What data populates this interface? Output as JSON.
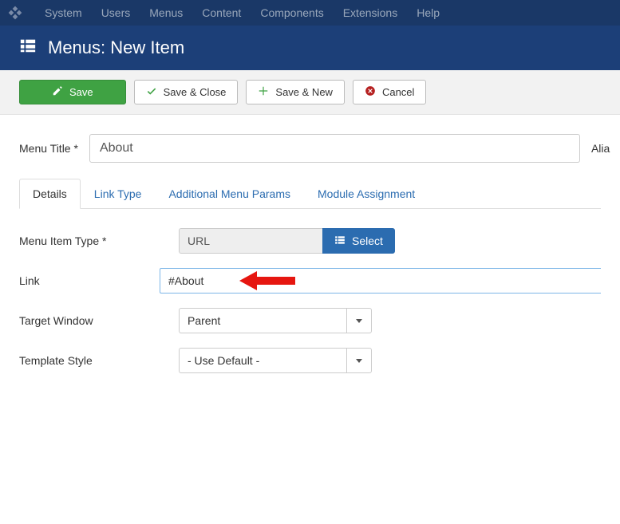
{
  "topnav": {
    "items": [
      "System",
      "Users",
      "Menus",
      "Content",
      "Components",
      "Extensions",
      "Help"
    ]
  },
  "header": {
    "title": "Menus: New Item"
  },
  "toolbar": {
    "save": "Save",
    "save_close": "Save & Close",
    "save_new": "Save & New",
    "cancel": "Cancel"
  },
  "title_field": {
    "label": "Menu Title *",
    "value": "About"
  },
  "alias_label": "Alia",
  "tabs": {
    "details": "Details",
    "link_type": "Link Type",
    "additional": "Additional Menu Params",
    "module": "Module Assignment"
  },
  "fields": {
    "item_type": {
      "label": "Menu Item Type *",
      "value": "URL",
      "select_btn": "Select"
    },
    "link": {
      "label": "Link",
      "value": "#About"
    },
    "target": {
      "label": "Target Window",
      "value": "Parent"
    },
    "template": {
      "label": "Template Style",
      "value": "- Use Default -"
    }
  }
}
